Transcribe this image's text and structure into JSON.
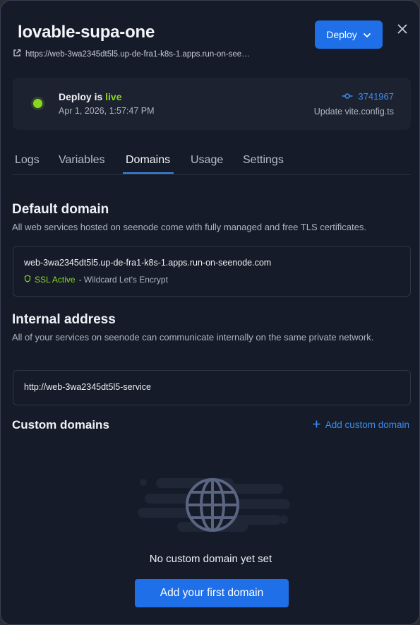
{
  "header": {
    "title": "lovable-supa-one",
    "url": "https://web-3wa2345dt5l5.up-de-fra1-k8s-1.apps.run-on-see…",
    "deploy_label": "Deploy"
  },
  "status": {
    "prefix": "Deploy is ",
    "state": "live",
    "date": "Apr 1, 2026, 1:57:47 PM",
    "commit_hash": "3741967",
    "commit_message": "Update vite.config.ts",
    "live_color": "#8bd61f"
  },
  "tabs": [
    {
      "label": "Logs"
    },
    {
      "label": "Variables"
    },
    {
      "label": "Domains"
    },
    {
      "label": "Usage"
    },
    {
      "label": "Settings"
    }
  ],
  "active_tab": "Domains",
  "default_domain": {
    "title": "Default domain",
    "description": "All web services hosted on seenode come with fully managed and free TLS certificates.",
    "domain": "web-3wa2345dt5l5.up-de-fra1-k8s-1.apps.run-on-seenode.com",
    "ssl_status": "SSL Active",
    "ssl_detail": "- Wildcard Let's Encrypt"
  },
  "internal": {
    "title": "Internal address",
    "description": "All of your services on seenode can communicate internally on the same private network.",
    "address": "http://web-3wa2345dt5l5-service"
  },
  "custom": {
    "title": "Custom domains",
    "add_label": "Add custom domain",
    "empty_text": "No custom domain yet set",
    "first_button": "Add your first domain"
  },
  "colors": {
    "accent": "#1f6fe8",
    "link": "#3b8cf2",
    "background": "#151b28"
  }
}
